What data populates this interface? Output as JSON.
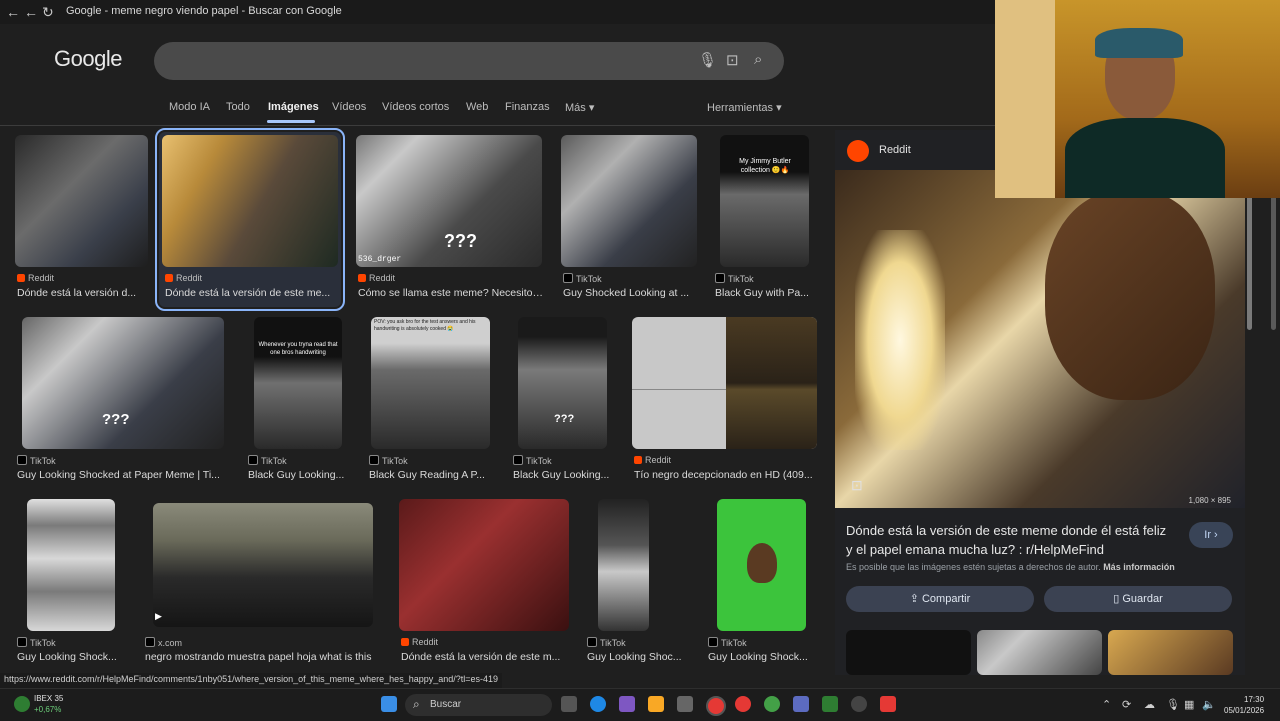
{
  "window": {
    "title": "Google - meme negro viendo papel - Buscar con Google"
  },
  "google": {
    "logo": "Google"
  },
  "tabs": [
    {
      "label": "Modo IA",
      "active": false
    },
    {
      "label": "Todo",
      "active": false
    },
    {
      "label": "Imágenes",
      "active": true
    },
    {
      "label": "Vídeos",
      "active": false
    },
    {
      "label": "Vídeos cortos",
      "active": false
    },
    {
      "label": "Web",
      "active": false
    },
    {
      "label": "Finanzas",
      "active": false
    },
    {
      "label": "Más ▾",
      "active": false
    }
  ],
  "tools_label": "Herramientas ▾",
  "results": [
    {
      "source": "Reddit",
      "caption": "Dónde está la versión d...",
      "color": "#ff4500"
    },
    {
      "source": "Reddit",
      "caption": "Dónde está la versión de este me...",
      "color": "#ff4500"
    },
    {
      "source": "Reddit",
      "caption": "Cómo se llama este meme? Necesito ...",
      "color": "#ff4500",
      "overlay": "???",
      "watermark": "536_drger"
    },
    {
      "source": "TikTok",
      "caption": "Guy Shocked Looking at ...",
      "color": "#000000"
    },
    {
      "source": "TikTok",
      "caption": "Black Guy with Pa...",
      "color": "#000000",
      "overlay": "My Jimmy Butler collection 🙂🔥"
    },
    {
      "source": "TikTok",
      "caption": "Guy Looking Shocked at Paper Meme | Ti...",
      "color": "#000000",
      "overlay": "???"
    },
    {
      "source": "TikTok",
      "caption": "Black Guy Looking...",
      "color": "#000000",
      "overlay": "Whenever you tryna read that one bros handwriting"
    },
    {
      "source": "TikTok",
      "caption": "Black Guy Reading A P...",
      "color": "#000000",
      "overlay": "POV: you ask bro for the test answers and his handwriting is absolutely cooked 😭"
    },
    {
      "source": "TikTok",
      "caption": "Black Guy Looking...",
      "color": "#000000",
      "overlay": "???"
    },
    {
      "source": "Reddit",
      "caption": "Tío negro decepcionado en HD (409...",
      "color": "#ff4500"
    },
    {
      "source": "TikTok",
      "caption": "Guy Looking Shock...",
      "color": "#000000"
    },
    {
      "source": "x.com",
      "caption": "negro mostrando muestra papel hoja what is this",
      "color": "#000000"
    },
    {
      "source": "Reddit",
      "caption": "Dónde está la versión de este m...",
      "color": "#ff4500"
    },
    {
      "source": "TikTok",
      "caption": "Guy Looking Shoc...",
      "color": "#000000"
    },
    {
      "source": "TikTok",
      "caption": "Guy Looking Shock...",
      "color": "#000000"
    }
  ],
  "panel": {
    "source": "Reddit",
    "dimensions": "1,080 × 895",
    "title": "Dónde está la versión de este meme donde él está feliz y el papel emana mucha luz? : r/HelpMeFind",
    "visit_label": "Ir ›",
    "copyright": "Es posible que las imágenes estén sujetas a derechos de autor.",
    "more_info": "Más información",
    "share_label": "Compartir",
    "save_label": "Guardar"
  },
  "status_url": "https://www.reddit.com/r/HelpMeFind/comments/1nby051/where_version_of_this_meme_where_hes_happy_and/?tl=es-419",
  "taskbar": {
    "ticker_name": "IBEX 35",
    "ticker_change": "+0,67%",
    "search_label": "Buscar",
    "time": "17:30",
    "date": "05/01/2026"
  },
  "colors": {
    "accent": "#8ab4f8",
    "reddit": "#ff4500",
    "background": "#1f1f1f"
  }
}
